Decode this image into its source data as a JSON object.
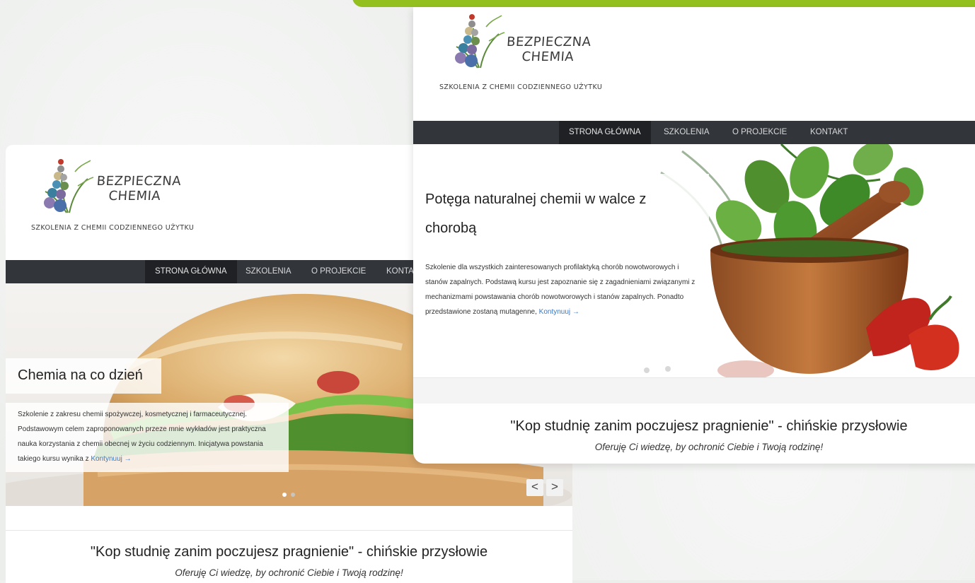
{
  "brand": {
    "name_line1": "BEZPIECZNA",
    "name_line2": "CHEMIA",
    "tagline": "SZKOLENIA Z CHEMII CODZIENNEGO UŻYTKU"
  },
  "nav": {
    "items": [
      {
        "label": "STRONA GŁÓWNA"
      },
      {
        "label": "SZKOLENIA"
      },
      {
        "label": "O PROJEKCIE"
      },
      {
        "label": "KONTAKT"
      }
    ],
    "left_clipped_label": "KONTA"
  },
  "left_page": {
    "slide_title": "Chemia na co dzień",
    "slide_text": "Szkolenie z zakresu chemii spożywczej, kosmetycznej i farmaceutycznej. Podstawowym celem zaproponowanych przeze mnie wykładów jest praktyczna nauka korzystania z chemii obecnej w życiu codziennym. Inicjatywa powstania takiego kursu wynika z",
    "read_more": "Kontynuuj →",
    "prev_label": "<",
    "next_label": ">"
  },
  "right_page": {
    "slide_title_line1": "Potęga naturalnej chemii w walce z",
    "slide_title_line2": "chorobą",
    "slide_text": "Szkolenie dla wszystkich zainteresowanych profilaktyką chorób nowotworowych i stanów zapalnych. Podstawą kursu jest zapoznanie się z zagadnieniami związanymi z mechanizmami powstawania chorób nowotworowych i stanów zapalnych. Ponadto przedstawione zostaną mutagenne,",
    "read_more": "Kontynuuj →"
  },
  "quote": {
    "text": "\"Kop studnię zanim poczujesz pragnienie\" - chińskie przysłowie",
    "subtitle": "Oferuję Ci wiedzę, by ochronić Ciebie i Twoją rodzinę!"
  },
  "colors": {
    "accent_green": "#93c01f",
    "nav_bg": "#32353a",
    "nav_active_bg": "#1f2125",
    "link_blue": "#3a78c2"
  }
}
